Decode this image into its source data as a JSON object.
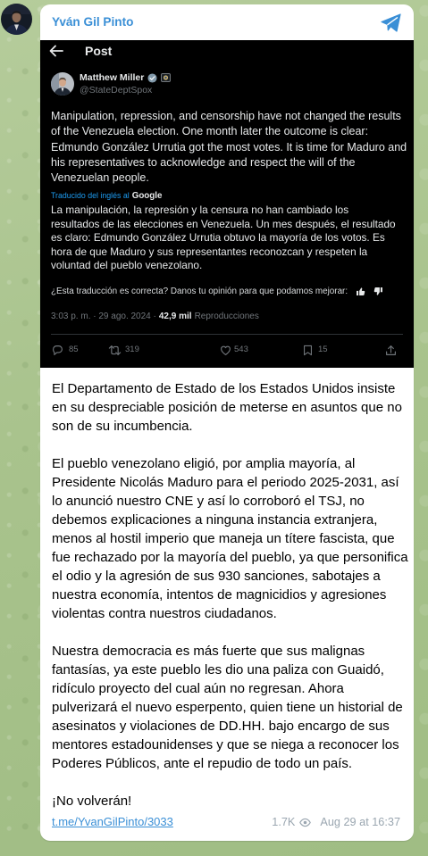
{
  "channel": {
    "name": "Yván Gil Pinto"
  },
  "embedded_post": {
    "nav": {
      "title": "Post"
    },
    "author": {
      "name": "Matthew Miller",
      "handle": "@StateDeptSpox"
    },
    "text_lines": [
      "Manipulation, repression, and censorship have not changed the results",
      "of the Venezuela election. One month later the outcome is clear:",
      "Edmundo González Urrutia got the most votes. It is time for Maduro and",
      "his representatives to acknowledge and respect the will of the",
      "Venezuelan people."
    ],
    "translation": {
      "label": "Traducido del inglés al",
      "provider": "Google",
      "lines": [
        "La manipulación, la represión y la censura no han cambiado los",
        "resultados de las elecciones en Venezuela. Un mes después, el resultado",
        "es claro: Edmundo González Urrutia obtuvo la mayoría de los votos. Es",
        "hora de que Maduro y sus representantes reconozcan y respeten la",
        "voluntad del pueblo venezolano."
      ],
      "feedback": "¿Esta traducción es correcta? Danos tu opinión para que podamos mejorar:"
    },
    "meta": {
      "timestamp": "3:03 p. m. · 29 ago. 2024 ·",
      "views": "42,9 mil",
      "views_label": "Reproducciones"
    },
    "actions": {
      "replies": "85",
      "reposts": "319",
      "likes": "543",
      "bookmarks": "15"
    }
  },
  "message": {
    "paragraphs": [
      [
        "El Departamento de Estado de los Estados Unidos insiste",
        "en su despreciable posición de meterse en asuntos que no",
        "son de su incumbencia."
      ],
      [
        "El pueblo venezolano eligió, por amplia mayoría, al",
        "Presidente Nicolás Maduro para el periodo 2025-2031, así",
        "lo anunció nuestro CNE y así lo corroboró el TSJ, no",
        "debemos explicaciones a ninguna instancia extranjera,",
        "menos al hostil imperio que maneja un títere fascista, que",
        "fue rechazado por la mayoría del pueblo, ya que personifica",
        "el odio y la agresión de sus 930 sanciones, sabotajes a",
        "nuestra economía, intentos de magnicidios y agresiones",
        "violentas contra nuestros ciudadanos."
      ],
      [
        "Nuestra democracia es más fuerte que sus malignas",
        "fantasías, ya este pueblo les dio una paliza con Guaidó,",
        "ridículo proyecto del cual aún no regresan. Ahora",
        "pulverizará el nuevo esperpento, quien tiene un historial de",
        "asesinatos y violaciones de DD.HH. bajo encargo de sus",
        "mentores estadounidenses y que se niega a reconocer los",
        "Poderes Públicos, ante el repudio de todo un país."
      ],
      [
        "¡No volverán!"
      ]
    ]
  },
  "footer": {
    "link": "t.me/YvanGilPinto/3033",
    "views": "1.7K",
    "date": "Aug 29 at 16:37"
  },
  "icons": {
    "channel_avatar": "channel-avatar",
    "share": "share-paper-plane-icon",
    "back": "back-arrow-icon",
    "verified": "verified-badge-icon",
    "affiliation": "affiliation-badge-icon",
    "thumbs_up": "thumbs-up-icon",
    "thumbs_down": "thumbs-down-icon",
    "reply": "reply-icon",
    "repost": "repost-icon",
    "like": "like-icon",
    "bookmark": "bookmark-icon",
    "post_share": "share-icon",
    "views": "eye-icon"
  },
  "colors": {
    "accent": "#3a8fd6",
    "bubble": "#ffffff",
    "embed_background": "#000000",
    "embed_text": "#e7e9ea",
    "embed_muted": "#71767b",
    "translation_link": "#1d9bf0",
    "chat_background": "#a9c38d"
  }
}
